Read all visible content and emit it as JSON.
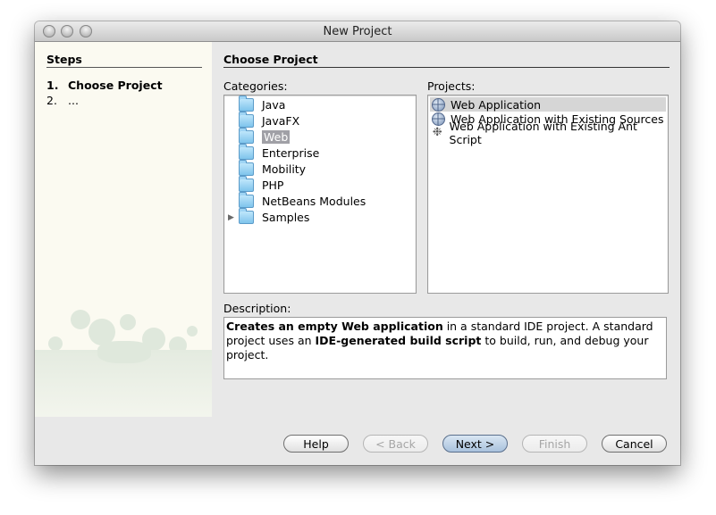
{
  "window": {
    "title": "New Project"
  },
  "steps": {
    "heading": "Steps",
    "items": [
      {
        "num": "1.",
        "label": "Choose Project",
        "current": true
      },
      {
        "num": "2.",
        "label": "...",
        "current": false
      }
    ]
  },
  "main": {
    "heading": "Choose Project",
    "categories_label": "Categories:",
    "projects_label": "Projects:",
    "description_label": "Description:"
  },
  "categories": [
    {
      "label": "Java",
      "expandable": false,
      "selected": false
    },
    {
      "label": "JavaFX",
      "expandable": false,
      "selected": false
    },
    {
      "label": "Web",
      "expandable": false,
      "selected": true
    },
    {
      "label": "Enterprise",
      "expandable": false,
      "selected": false
    },
    {
      "label": "Mobility",
      "expandable": false,
      "selected": false
    },
    {
      "label": "PHP",
      "expandable": false,
      "selected": false
    },
    {
      "label": "NetBeans Modules",
      "expandable": false,
      "selected": false
    },
    {
      "label": "Samples",
      "expandable": true,
      "selected": false
    }
  ],
  "projects": [
    {
      "label": "Web Application",
      "icon": "globe-icon",
      "selected": true
    },
    {
      "label": "Web Application with Existing Sources",
      "icon": "globe-icon",
      "selected": false
    },
    {
      "label": "Web Application with Existing Ant Script",
      "icon": "bug-icon",
      "selected": false
    }
  ],
  "description": {
    "bold1": "Creates an empty Web application",
    "text1": " in a standard IDE project. A standard project uses an ",
    "bold2": "IDE-generated build script",
    "text2": " to build, run, and debug your project."
  },
  "buttons": {
    "help": "Help",
    "back": "< Back",
    "next": "Next >",
    "finish": "Finish",
    "cancel": "Cancel"
  },
  "colors": {
    "selection_gray": "#a0a0a6",
    "steps_panel_bg": "#fbfaf1",
    "default_button": "#a9c2dd"
  }
}
